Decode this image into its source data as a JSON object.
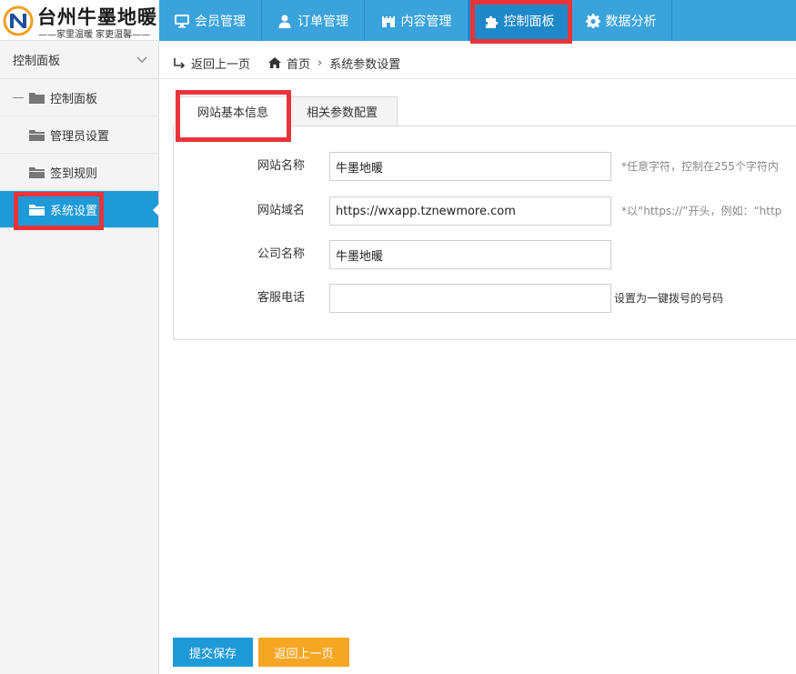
{
  "logo": {
    "mark": "N",
    "title": "台州牛墨地暖",
    "subtitle": "——家里温暖 家更温馨——"
  },
  "nav": {
    "items": [
      {
        "label": "会员管理",
        "icon": "monitor-icon"
      },
      {
        "label": "订单管理",
        "icon": "user-icon"
      },
      {
        "label": "内容管理",
        "icon": "castle-icon"
      },
      {
        "label": "控制面板",
        "icon": "puzzle-icon"
      },
      {
        "label": "数据分析",
        "icon": "gear-icon"
      }
    ],
    "active_index": 3
  },
  "sidebar": {
    "header": "控制面板",
    "items": [
      {
        "label": "控制面板",
        "icon": "folder-icon"
      },
      {
        "label": "管理员设置",
        "icon": "folder-icon"
      },
      {
        "label": "签到规则",
        "icon": "folder-icon"
      },
      {
        "label": "系统设置",
        "icon": "folder-open-icon"
      }
    ],
    "active_index": 3
  },
  "breadcrumb": {
    "back": "返回上一页",
    "home": "首页",
    "current": "系统参数设置"
  },
  "tabs": [
    {
      "label": "网站基本信息"
    },
    {
      "label": "相关参数配置"
    }
  ],
  "form": {
    "site_name": {
      "label": "网站名称",
      "value": "牛墨地暖",
      "hint": "*任意字符，控制在255个字符内"
    },
    "site_domain": {
      "label": "网站域名",
      "value": "https://wxapp.tznewmore.com",
      "hint": "*以“https://”开头，例如：“http"
    },
    "company_name": {
      "label": "公司名称",
      "value": "牛墨地暖"
    },
    "service_phone": {
      "label": "客服电话",
      "value": "",
      "hint": "设置为一键拨号的号码"
    }
  },
  "buttons": {
    "submit": "提交保存",
    "back": "返回上一页"
  },
  "colors": {
    "topbar": "#3aa3dc",
    "active": "#1e9ad9",
    "highlight": "#e8343a",
    "back_button": "#f5a623"
  }
}
